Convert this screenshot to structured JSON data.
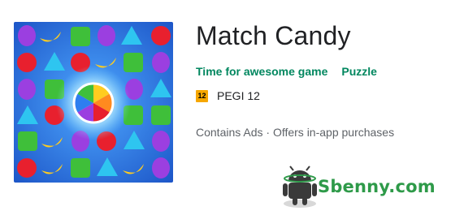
{
  "app": {
    "title": "Match Candy",
    "developer": "Time for awesome game",
    "category": "Puzzle",
    "rating_badge": "12",
    "rating_label": "PEGI 12",
    "ads_info": "Contains Ads · Offers in-app purchases"
  },
  "icon": {
    "name": "match-candy-app-icon",
    "background_color": "#2f6fe0"
  },
  "watermark": {
    "text": "Sbenny.com",
    "color": "#2e9a49"
  }
}
